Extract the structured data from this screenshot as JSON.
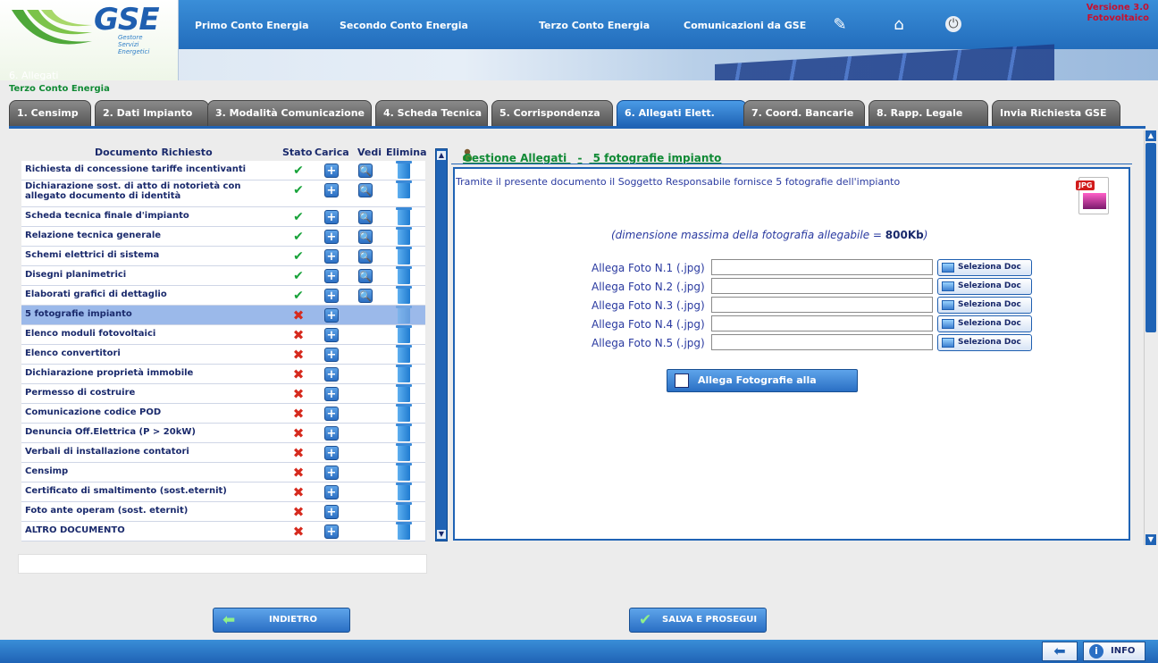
{
  "header": {
    "logo": "GSE",
    "logo_sub": [
      "Gestore",
      "Servizi",
      "Energetici"
    ],
    "section": "6. Allegati",
    "version_line1": "Versione 3.0",
    "version_line2": "Fotovoltaico",
    "nav": [
      "Primo Conto Energia",
      "Secondo Conto Energia",
      "Terzo Conto Energia",
      "Comunicazioni da GSE"
    ]
  },
  "subtitle": "Terzo Conto Energia",
  "tabs": [
    "1. Censimp",
    "2. Dati Impianto",
    "3. Modalità Comunicazione",
    "4. Scheda Tecnica",
    "5. Corrispondenza",
    "6. Allegati Elett.",
    "7. Coord. Bancarie",
    "8. Rapp. Legale",
    "Invia Richiesta GSE"
  ],
  "table": {
    "headers": {
      "documento": "Documento Richiesto",
      "stato": "Stato",
      "carica": "Carica",
      "vedi": "Vedi",
      "elimina": "Elimina"
    },
    "rows": [
      {
        "label": "Richiesta di concessione tariffe incentivanti",
        "status": "ok"
      },
      {
        "label": "Dichiarazione sost. di atto di notorietà con allegato documento di identità",
        "status": "ok"
      },
      {
        "label": "Scheda tecnica finale d'impianto",
        "status": "ok"
      },
      {
        "label": "Relazione tecnica generale",
        "status": "ok"
      },
      {
        "label": "Schemi elettrici di sistema",
        "status": "ok"
      },
      {
        "label": "Disegni planimetrici",
        "status": "ok"
      },
      {
        "label": "Elaborati grafici di dettaglio",
        "status": "ok"
      },
      {
        "label": "5 fotografie impianto",
        "status": "ko"
      },
      {
        "label": "Elenco moduli fotovoltaici",
        "status": "ko"
      },
      {
        "label": "Elenco convertitori",
        "status": "ko"
      },
      {
        "label": "Dichiarazione proprietà immobile",
        "status": "ko"
      },
      {
        "label": "Permesso di costruire",
        "status": "ko"
      },
      {
        "label": "Comunicazione codice POD",
        "status": "ko"
      },
      {
        "label": "Denuncia Off.Elettrica (P > 20kW)",
        "status": "ko"
      },
      {
        "label": "Verbali di installazione contatori",
        "status": "ko"
      },
      {
        "label": "Censimp",
        "status": "ko"
      },
      {
        "label": "Certificato di smaltimento (sost.eternit)",
        "status": "ko"
      },
      {
        "label": "Foto ante operam (sost. eternit)",
        "status": "ko"
      },
      {
        "label": "ALTRO DOCUMENTO",
        "status": "ko"
      }
    ]
  },
  "panel": {
    "title_left": "Gestione Allegati",
    "title_sep": "-",
    "title_right": "5 fotografie impianto",
    "description": "Tramite il presente documento il Soggetto Responsabile fornisce 5 fotografie dell'impianto",
    "jpg_tag": "JPG",
    "maxsize_prefix": "(dimensione massima della fotografia allegabile =",
    "maxsize_value": "800Kb",
    "maxsize_suffix": ")",
    "foto_rows": [
      {
        "label": "Allega Foto N.1  (.jpg)",
        "button": "Seleziona Doc"
      },
      {
        "label": "Allega Foto N.2  (.jpg)",
        "button": "Seleziona Doc"
      },
      {
        "label": "Allega Foto N.3  (.jpg)",
        "button": "Seleziona Doc"
      },
      {
        "label": "Allega Foto N.4  (.jpg)",
        "button": "Seleziona Doc"
      },
      {
        "label": "Allega Foto N.5  (.jpg)",
        "button": "Seleziona Doc"
      }
    ],
    "attach_button": "Allega Fotografie alla Pratica"
  },
  "footer": {
    "back": "INDIETRO",
    "save": "SALVA E PROSEGUI",
    "info": "INFO"
  },
  "colors": {
    "accent": "#1f63b5",
    "ok": "#18a33a",
    "ko": "#d62a1e",
    "subtitle": "#118a35"
  }
}
